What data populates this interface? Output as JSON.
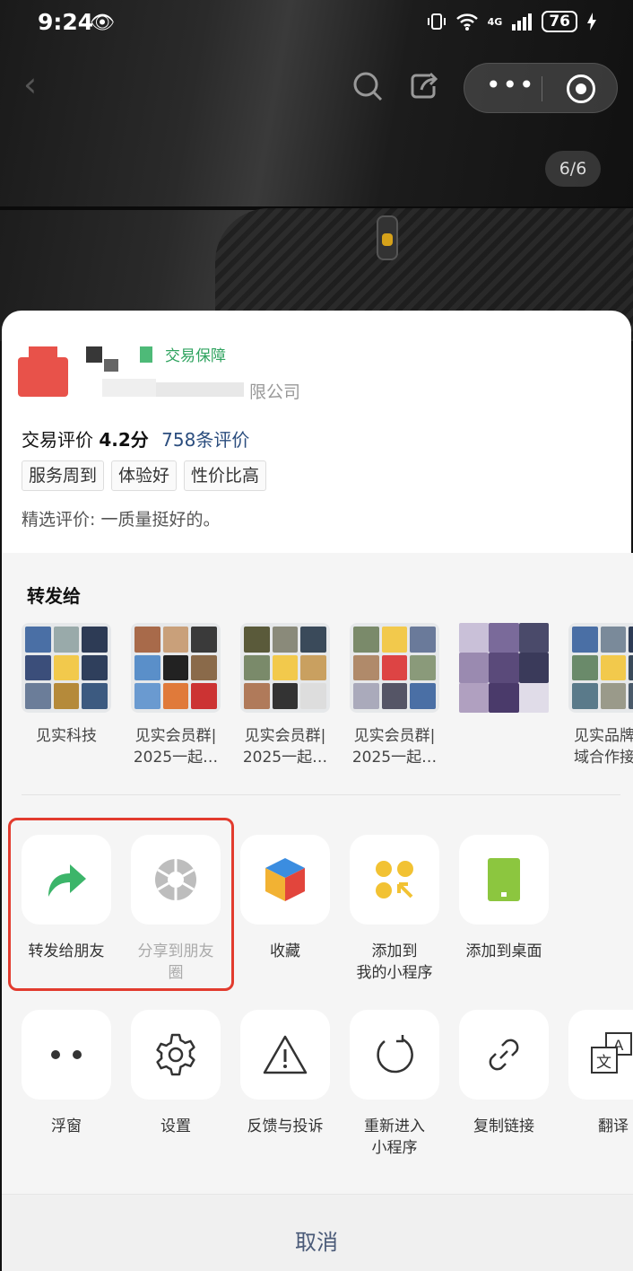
{
  "status_bar": {
    "time": "9:24",
    "eye_glyph": "👁",
    "signal_text": "4G",
    "battery": "76"
  },
  "photo": {
    "pager": "6/6"
  },
  "seller": {
    "green_label": "交易保障",
    "company_tail": "限公司"
  },
  "rating": {
    "label": "交易评价",
    "score": "4.2分",
    "count_link": "758条评价"
  },
  "tags": [
    "服务周到",
    "体验好",
    "性价比高"
  ],
  "review": "精选评价: 一质量挺好的。",
  "share": {
    "title": "转发给",
    "contacts": [
      {
        "name": "见实科技"
      },
      {
        "name": "见实会员群|\n2025一起…"
      },
      {
        "name": "见实会员群|\n2025一起…"
      },
      {
        "name": "见实会员群|\n2025一起…"
      },
      {
        "name": ""
      },
      {
        "name": "见实品牌\n域合作接"
      }
    ],
    "actions_row1": [
      {
        "label": "转发给朋友",
        "icon": "forward-arrow-icon"
      },
      {
        "label": "分享到朋友\n圈",
        "icon": "moments-aperture-icon"
      },
      {
        "label": "收藏",
        "icon": "favorites-cube-icon"
      },
      {
        "label": "添加到\n我的小程序",
        "icon": "mini-program-icon"
      },
      {
        "label": "添加到桌面",
        "icon": "desktop-phone-icon"
      }
    ],
    "actions_row2": [
      {
        "label": "浮窗",
        "icon": "float-window-icon"
      },
      {
        "label": "设置",
        "icon": "gear-icon"
      },
      {
        "label": "反馈与投诉",
        "icon": "warning-icon"
      },
      {
        "label": "重新进入\n小程序",
        "icon": "reload-icon"
      },
      {
        "label": "复制链接",
        "icon": "link-icon"
      },
      {
        "label": "翻译",
        "icon": "translate-icon"
      }
    ],
    "cancel": "取消"
  },
  "colors": {
    "forward_green": "#3cb56a",
    "highlight_red": "#e23b2e",
    "link_blue": "#2b4d7e",
    "cancel_text": "#4a5a78"
  }
}
